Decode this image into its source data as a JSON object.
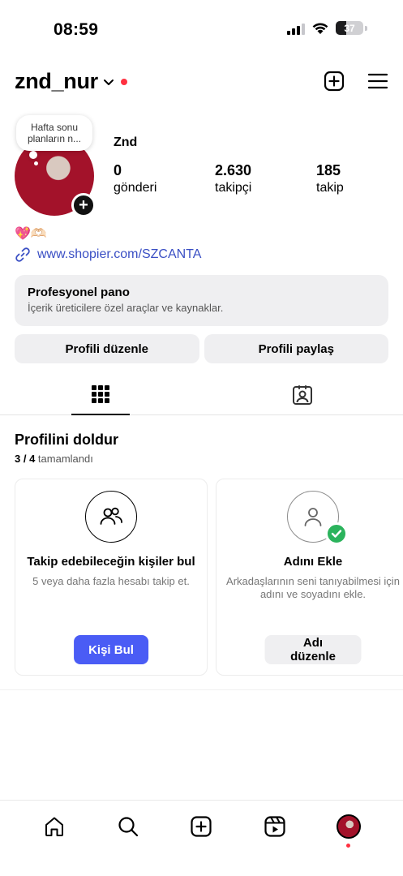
{
  "status_bar": {
    "time": "08:59",
    "battery_level": "37",
    "signal_bars": 3
  },
  "header": {
    "username": "znd_nur",
    "icons": [
      "chevron-down-icon",
      "new-post-icon",
      "menu-icon"
    ]
  },
  "profile": {
    "note": "Hafta sonu planların n...",
    "full_name": "Znd",
    "stats": [
      {
        "value": "0",
        "label": "gönderi"
      },
      {
        "value": "2.630",
        "label": "takipçi"
      },
      {
        "value": "185",
        "label": "takip"
      }
    ],
    "bio_emoji": "💖🫶🏻",
    "link": "www.shopier.com/SZCANTA"
  },
  "pro_panel": {
    "title": "Profesyonel pano",
    "subtitle": "İçerik üreticilere özel araçlar ve kaynaklar."
  },
  "actions": {
    "edit_profile": "Profili düzenle",
    "share_profile": "Profili paylaş"
  },
  "tabs": [
    {
      "icon": "grid-icon",
      "active": true
    },
    {
      "icon": "tagged-icon",
      "active": false
    }
  ],
  "complete_profile": {
    "title": "Profilini doldur",
    "progress_done": "3 / 4",
    "progress_label": "tamamlandı",
    "cards": [
      {
        "icon": "people-icon",
        "title": "Takip edebileceğin kişiler bul",
        "subtitle": "5 veya daha fazla hesabı takip et.",
        "button": "Kişi Bul",
        "completed": false
      },
      {
        "icon": "person-icon",
        "title": "Adını Ekle",
        "subtitle": "Arkadaşlarının seni tanıyabilmesi için adını ve soyadını ekle.",
        "button": "Adı düzenle",
        "completed": true
      }
    ]
  },
  "bottom_nav": [
    "home-icon",
    "search-icon",
    "create-icon",
    "reels-icon",
    "profile-avatar"
  ],
  "colors": {
    "accent": "#4a5cf5",
    "link": "#3a4fc4",
    "notification": "#ff3040",
    "success": "#2bb35c",
    "panel": "#efeff1"
  }
}
